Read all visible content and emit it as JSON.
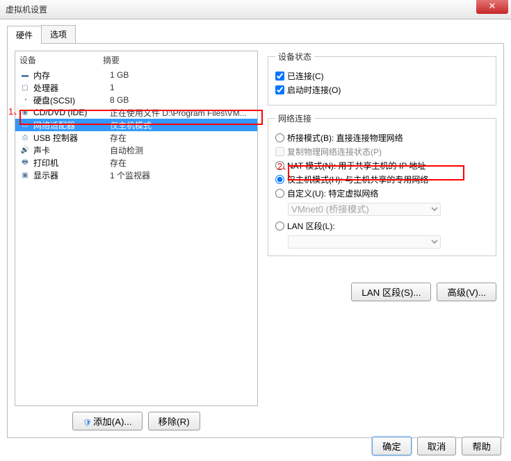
{
  "window": {
    "title": "虚拟机设置",
    "close": "✕"
  },
  "tabs": {
    "hardware": "硬件",
    "options": "选项"
  },
  "headers": {
    "device": "设备",
    "summary": "摘要"
  },
  "devices": [
    {
      "icon": "▬",
      "name": "内存",
      "summary": "1 GB"
    },
    {
      "icon": "▢",
      "name": "处理器",
      "summary": "1"
    },
    {
      "icon": "◔",
      "name": "硬盘(SCSI)",
      "summary": "8 GB"
    },
    {
      "icon": "◉",
      "name": "CD/DVD (IDE)",
      "summary": "正在使用文件 D:\\Program Files\\VM..."
    },
    {
      "icon": "▭",
      "name": "网络适配器",
      "summary": "仅主机模式"
    },
    {
      "icon": "⎙",
      "name": "USB 控制器",
      "summary": "存在"
    },
    {
      "icon": "🔊",
      "name": "声卡",
      "summary": "自动检测"
    },
    {
      "icon": "🖶",
      "name": "打印机",
      "summary": "存在"
    },
    {
      "icon": "▣",
      "name": "显示器",
      "summary": "1 个监视器"
    }
  ],
  "selectedIndex": 4,
  "add_btn": "添加(A)...",
  "remove_btn": "移除(R)",
  "status_group": "设备状态",
  "status_connected": "已连接(C)",
  "status_onstart": "启动时连接(O)",
  "net_group": "网络连接",
  "net_bridged": "桥接模式(B): 直接连接物理网络",
  "net_replicate": "复制物理网络连接状态(P)",
  "net_nat": "NAT 模式(N): 用于共享主机的 IP 地址",
  "net_hostonly": "仅主机模式(H): 与主机共享的专用网络",
  "net_custom": "自定义(U): 特定虚拟网络",
  "net_custom_select": "VMnet0 (桥接模式)",
  "net_lan": "LAN 区段(L):",
  "lan_btn": "LAN 区段(S)...",
  "adv_btn": "高级(V)...",
  "ok": "确定",
  "cancel": "取消",
  "help": "帮助",
  "annot1": "1、",
  "annot2": "2、"
}
